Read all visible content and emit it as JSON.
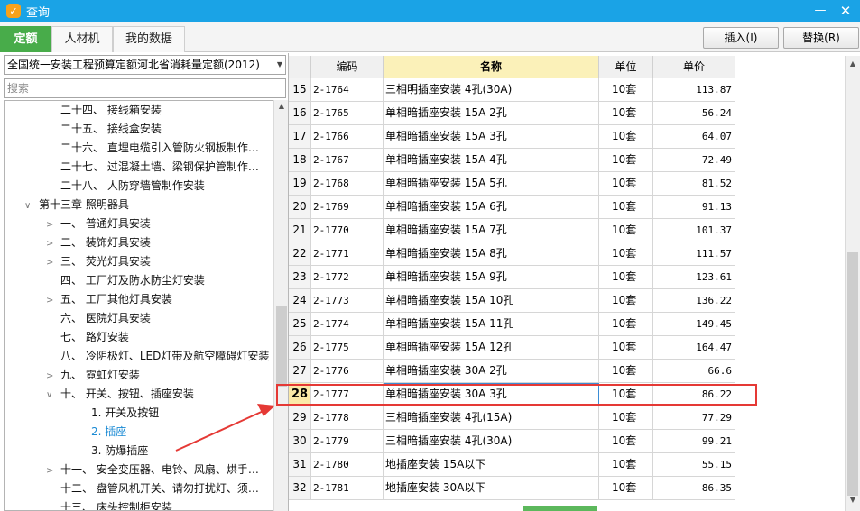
{
  "window": {
    "title": "查询",
    "min_label": "—",
    "close_label": "✕",
    "app_icon_glyph": "✓",
    "accent": "#1aa3e6"
  },
  "tabs": [
    {
      "label": "定额",
      "active": true
    },
    {
      "label": "人材机",
      "active": false
    },
    {
      "label": "我的数据",
      "active": false
    }
  ],
  "toolbar": {
    "insert_label": "插入(I)",
    "replace_label": "替换(R)"
  },
  "left_panel": {
    "quota_db": "全国统一安装工程预算定额河北省消耗量定额(2012)",
    "search_placeholder": "搜索",
    "tree": [
      {
        "indent": 2,
        "toggle": "",
        "label": "二十四、 接线箱安装"
      },
      {
        "indent": 2,
        "toggle": "",
        "label": "二十五、 接线盒安装"
      },
      {
        "indent": 2,
        "toggle": "",
        "label": "二十六、 直埋电缆引入管防火钢板制作…"
      },
      {
        "indent": 2,
        "toggle": "",
        "label": "二十七、 过混凝土墙、梁钢保护管制作…"
      },
      {
        "indent": 2,
        "toggle": "",
        "label": "二十八、 人防穿墙管制作安装"
      },
      {
        "indent": 1,
        "toggle": "∨",
        "label": "第十三章 照明器具"
      },
      {
        "indent": 2,
        "toggle": ">",
        "label": "一、 普通灯具安装"
      },
      {
        "indent": 2,
        "toggle": ">",
        "label": "二、 装饰灯具安装"
      },
      {
        "indent": 2,
        "toggle": ">",
        "label": "三、 荧光灯具安装"
      },
      {
        "indent": 2,
        "toggle": "",
        "label": "四、 工厂灯及防水防尘灯安装"
      },
      {
        "indent": 2,
        "toggle": ">",
        "label": "五、 工厂其他灯具安装"
      },
      {
        "indent": 2,
        "toggle": "",
        "label": "六、 医院灯具安装"
      },
      {
        "indent": 2,
        "toggle": "",
        "label": "七、 路灯安装"
      },
      {
        "indent": 2,
        "toggle": "",
        "label": "八、 冷阴极灯、LED灯带及航空障碍灯安装"
      },
      {
        "indent": 2,
        "toggle": ">",
        "label": "九、 霓虹灯安装"
      },
      {
        "indent": 2,
        "toggle": "∨",
        "label": "十、 开关、按钮、插座安装"
      },
      {
        "indent": 3,
        "toggle": "",
        "label": "1. 开关及按钮"
      },
      {
        "indent": 3,
        "toggle": "",
        "label": "2. 插座",
        "selected": true
      },
      {
        "indent": 3,
        "toggle": "",
        "label": "3. 防爆插座"
      },
      {
        "indent": 2,
        "toggle": ">",
        "label": "十一、 安全变压器、电铃、风扇、烘手…"
      },
      {
        "indent": 2,
        "toggle": "",
        "label": "十二、 盘管风机开关、请勿打扰灯、须…"
      },
      {
        "indent": 2,
        "toggle": "",
        "label": "十三、 床头控制柜安装"
      }
    ]
  },
  "grid": {
    "headers": [
      "",
      "编码",
      "名称",
      "单位",
      "单价"
    ],
    "selected_row": 28,
    "rows": [
      {
        "no": "15",
        "code": "2-1764",
        "name": "三相明插座安装 4孔(30A)",
        "unit": "10套",
        "price": "113.87"
      },
      {
        "no": "16",
        "code": "2-1765",
        "name": "单相暗插座安装 15A 2孔",
        "unit": "10套",
        "price": "56.24"
      },
      {
        "no": "17",
        "code": "2-1766",
        "name": "单相暗插座安装 15A 3孔",
        "unit": "10套",
        "price": "64.07"
      },
      {
        "no": "18",
        "code": "2-1767",
        "name": "单相暗插座安装 15A 4孔",
        "unit": "10套",
        "price": "72.49"
      },
      {
        "no": "19",
        "code": "2-1768",
        "name": "单相暗插座安装 15A 5孔",
        "unit": "10套",
        "price": "81.52"
      },
      {
        "no": "20",
        "code": "2-1769",
        "name": "单相暗插座安装 15A 6孔",
        "unit": "10套",
        "price": "91.13"
      },
      {
        "no": "21",
        "code": "2-1770",
        "name": "单相暗插座安装 15A 7孔",
        "unit": "10套",
        "price": "101.37"
      },
      {
        "no": "22",
        "code": "2-1771",
        "name": "单相暗插座安装 15A 8孔",
        "unit": "10套",
        "price": "111.57"
      },
      {
        "no": "23",
        "code": "2-1772",
        "name": "单相暗插座安装 15A 9孔",
        "unit": "10套",
        "price": "123.61"
      },
      {
        "no": "24",
        "code": "2-1773",
        "name": "单相暗插座安装 15A 10孔",
        "unit": "10套",
        "price": "136.22"
      },
      {
        "no": "25",
        "code": "2-1774",
        "name": "单相暗插座安装 15A 11孔",
        "unit": "10套",
        "price": "149.45"
      },
      {
        "no": "26",
        "code": "2-1775",
        "name": "单相暗插座安装 15A 12孔",
        "unit": "10套",
        "price": "164.47"
      },
      {
        "no": "27",
        "code": "2-1776",
        "name": "单相暗插座安装 30A 2孔",
        "unit": "10套",
        "price": "66.6"
      },
      {
        "no": "28",
        "code": "2-1777",
        "name": "单相暗插座安装 30A 3孔",
        "unit": "10套",
        "price": "86.22"
      },
      {
        "no": "29",
        "code": "2-1778",
        "name": "三相暗插座安装 4孔(15A)",
        "unit": "10套",
        "price": "77.29"
      },
      {
        "no": "30",
        "code": "2-1779",
        "name": "三相暗插座安装 4孔(30A)",
        "unit": "10套",
        "price": "99.21"
      },
      {
        "no": "31",
        "code": "2-1780",
        "name": "地插座安装 15A以下",
        "unit": "10套",
        "price": "55.15"
      },
      {
        "no": "32",
        "code": "2-1781",
        "name": "地插座安装 30A以下",
        "unit": "10套",
        "price": "86.35"
      }
    ]
  },
  "annotation_color": "#e53935"
}
